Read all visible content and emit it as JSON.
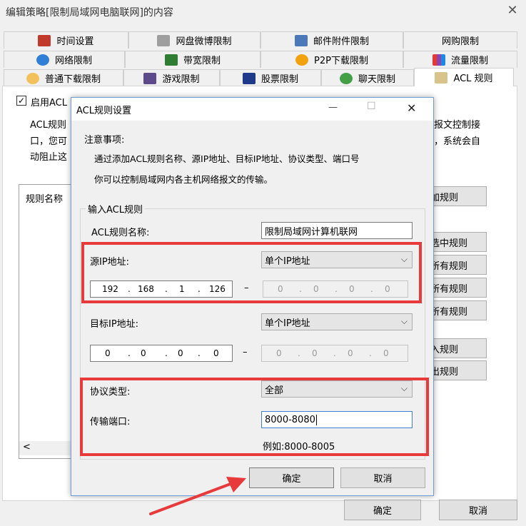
{
  "window": {
    "title": "编辑策略[限制局域网电脑联网]的内容",
    "close": "✕"
  },
  "tabs": {
    "row1": [
      "时间设置",
      "网盘微博限制",
      "邮件附件限制",
      "网购限制"
    ],
    "row2": [
      "网络限制",
      "带宽限制",
      "P2P下载限制",
      "流量限制"
    ],
    "row3": [
      "普通下载限制",
      "游戏限制",
      "股票限制",
      "聊天限制",
      "ACL 规则"
    ]
  },
  "panel": {
    "enable_acl": "启用ACL",
    "desc_line1": "ACL规则",
    "desc_line2": "口，您可",
    "desc_line3": "动阻止这",
    "desc_right1": "报文控制接",
    "desc_right2": "，系统会自",
    "rule_name_header": "规则名称",
    "scroll_left": "<",
    "buttons": [
      "加规则",
      "选中规则",
      "所有规则",
      "所有规则",
      "所有规则",
      "入规则",
      "出规则"
    ],
    "ok": "确定",
    "cancel": "取消"
  },
  "dialog": {
    "title": "ACL规则设置",
    "minimize": "—",
    "maximize": "☐",
    "close": "✕",
    "notes_title": "注意事项:",
    "notes_line1": "通过添加ACL规则名称、源IP地址、目标IP地址、协议类型、端口号",
    "notes_line2": "你可以控制局域网内各主机网络报文的传输。",
    "group_title": "输入ACL规则",
    "rule_name_label": "ACL规则名称:",
    "rule_name_value": "限制局域网计算机联网",
    "src_ip_label": "源IP地址:",
    "src_ip_mode": "单个IP地址",
    "src_ip": [
      "192",
      "168",
      "1",
      "126"
    ],
    "src_ip_end": [
      "0",
      "0",
      "0",
      "0"
    ],
    "dst_ip_label": "目标IP地址:",
    "dst_ip_mode": "单个IP地址",
    "dst_ip": [
      "0",
      "0",
      "0",
      "0"
    ],
    "dst_ip_end": [
      "0",
      "0",
      "0",
      "0"
    ],
    "range_dash": "–",
    "protocol_label": "协议类型:",
    "protocol_value": "全部",
    "port_label": "传输端口:",
    "port_value": "8000-8080",
    "port_example": "例如:8000-8005",
    "ok": "确定",
    "cancel": "取消"
  },
  "colors": {
    "highlight": "#e8393b",
    "arrow": "#e8393b"
  }
}
